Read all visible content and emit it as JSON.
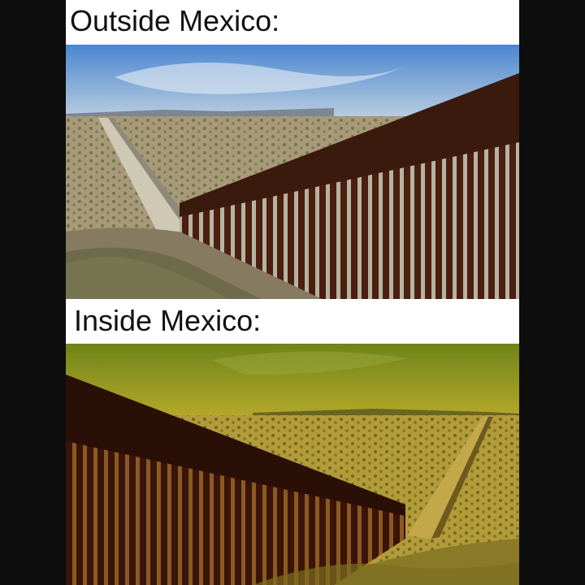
{
  "meme": {
    "top_caption": "Outside Mexico:",
    "bottom_caption": "Inside Mexico:"
  },
  "images": {
    "top_photo": "border-fence-desert-natural-color",
    "bottom_photo": "border-fence-desert-yellow-tint"
  },
  "colors": {
    "frame_background": "#0d0d0d",
    "caption_background": "#ffffff",
    "caption_text": "#111111",
    "top_sky": "#5a8fd0",
    "bottom_sky": "#8a9e1e",
    "fence_rust": "#5a2a16"
  }
}
